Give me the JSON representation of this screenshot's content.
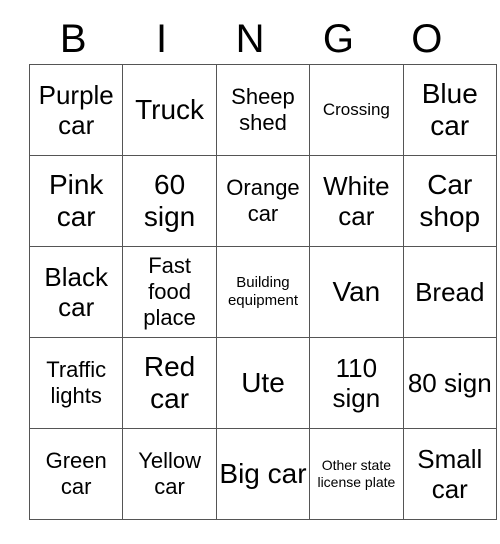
{
  "card": {
    "header_letters": [
      "B",
      "I",
      "N",
      "G",
      "O"
    ],
    "border_color": "#555555",
    "text_color": "#000000",
    "background_color": "#ffffff",
    "rows": [
      [
        {
          "text": "Purple car",
          "size": "lg"
        },
        {
          "text": "Truck",
          "size": "xl"
        },
        {
          "text": "Sheep shed",
          "size": "md"
        },
        {
          "text": "Crossing",
          "size": "sm"
        },
        {
          "text": "Blue car",
          "size": "xl"
        }
      ],
      [
        {
          "text": "Pink car",
          "size": "xl"
        },
        {
          "text": "60 sign",
          "size": "xl"
        },
        {
          "text": "Orange car",
          "size": "md"
        },
        {
          "text": "White car",
          "size": "lg"
        },
        {
          "text": "Car shop",
          "size": "xl"
        }
      ],
      [
        {
          "text": "Black car",
          "size": "lg"
        },
        {
          "text": "Fast food place",
          "size": "md"
        },
        {
          "text": "Building equipment",
          "size": "xs"
        },
        {
          "text": "Van",
          "size": "xl"
        },
        {
          "text": "Bread",
          "size": "lg"
        }
      ],
      [
        {
          "text": "Traffic lights",
          "size": "md"
        },
        {
          "text": "Red car",
          "size": "xl"
        },
        {
          "text": "Ute",
          "size": "xl"
        },
        {
          "text": "110 sign",
          "size": "lg"
        },
        {
          "text": "80 sign",
          "size": "lg"
        }
      ],
      [
        {
          "text": "Green car",
          "size": "md"
        },
        {
          "text": "Yellow car",
          "size": "md"
        },
        {
          "text": "Big car",
          "size": "xl"
        },
        {
          "text": "Other state license plate",
          "size": "xxs"
        },
        {
          "text": "Small car",
          "size": "lg"
        }
      ]
    ]
  }
}
